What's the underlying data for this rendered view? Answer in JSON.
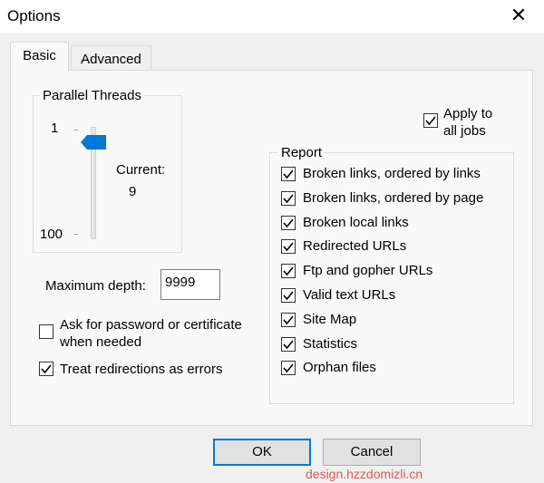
{
  "window": {
    "title": "Options",
    "close_glyph": "✕"
  },
  "tabs": [
    {
      "label": "Basic",
      "active": true
    },
    {
      "label": "Advanced",
      "active": false
    }
  ],
  "parallel_threads": {
    "group_label": "Parallel Threads",
    "min_label": "1",
    "max_label": "100",
    "current_label": "Current:",
    "current_value": "9",
    "slider_min": 1,
    "slider_max": 100,
    "slider_value": 9
  },
  "apply": {
    "label_line1": "Apply to",
    "label_line2": "all jobs",
    "checked": true
  },
  "max_depth": {
    "label": "Maximum depth:",
    "value": "9999"
  },
  "ask_password": {
    "label_line1": "Ask for password or certificate",
    "label_line2": "when needed",
    "checked": false
  },
  "treat_redirections": {
    "label": "Treat redirections as errors",
    "checked": true
  },
  "report": {
    "group_label": "Report",
    "items": [
      {
        "label": "Broken links, ordered by links",
        "checked": true
      },
      {
        "label": "Broken links, ordered by page",
        "checked": true
      },
      {
        "label": "Broken local links",
        "checked": true
      },
      {
        "label": "Redirected URLs",
        "checked": true
      },
      {
        "label": "Ftp and gopher URLs",
        "checked": true
      },
      {
        "label": "Valid text URLs",
        "checked": true
      },
      {
        "label": "Site Map",
        "checked": true
      },
      {
        "label": "Statistics",
        "checked": true
      },
      {
        "label": "Orphan files",
        "checked": true
      }
    ]
  },
  "buttons": {
    "ok": "OK",
    "cancel": "Cancel"
  },
  "watermark": "design.hzzdomizli.cn",
  "colors": {
    "accent": "#0078d7",
    "slider_thumb": "#0078d7",
    "watermark": "#e2483f"
  },
  "icons": {
    "close": "close-icon",
    "check": "checkmark-icon"
  }
}
